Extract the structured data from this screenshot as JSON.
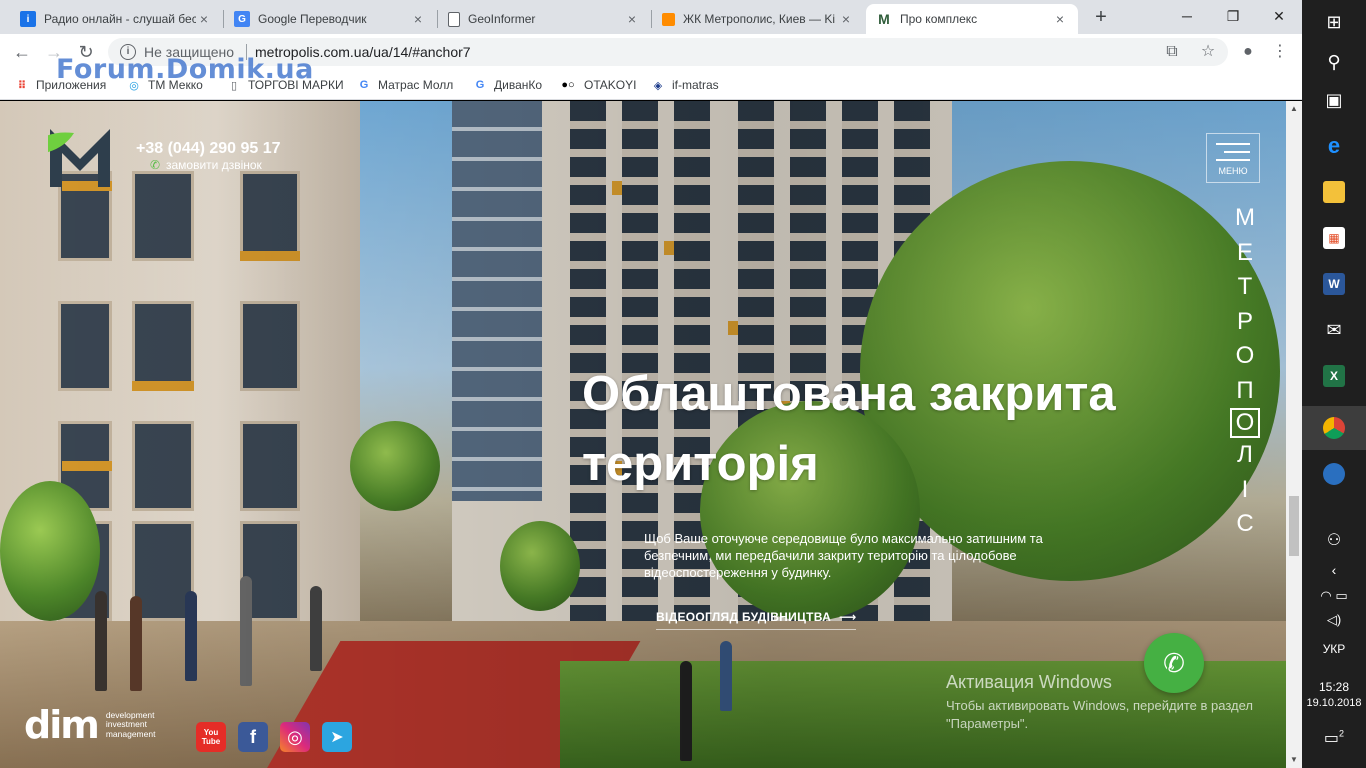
{
  "browser": {
    "tabs": [
      {
        "title": "Радио онлайн - слушай бес",
        "icon": "radio-icon",
        "color": "#1a73e8"
      },
      {
        "title": "Google Переводчик",
        "icon": "google-translate-icon",
        "color": "#4285f4"
      },
      {
        "title": "GeoInformer",
        "icon": "page-icon",
        "color": "#ffffff"
      },
      {
        "title": "ЖК Метрополис, Киев — Ki",
        "icon": "orange-square-icon",
        "color": "#ff8c00"
      },
      {
        "title": "Про комплекс",
        "icon": "metropolis-m-icon",
        "color": "#2f5d3a"
      }
    ],
    "address": {
      "security": "Не защищено",
      "url": "metropolis.com.ua/ua/14/#anchor7"
    },
    "bookmarks": [
      {
        "label": "Приложения",
        "icon": "apps-grid-icon"
      },
      {
        "label": "ТМ Мекко",
        "icon": "circle-logo-icon"
      },
      {
        "label": "ТОРГОВІ МАРКИ",
        "icon": "page-icon"
      },
      {
        "label": "Матрас Молл",
        "icon": "google-g-icon"
      },
      {
        "label": "ДиванКо",
        "icon": "google-g-icon"
      },
      {
        "label": "OTAKOYI",
        "icon": "dots-icon"
      },
      {
        "label": "if-matras",
        "icon": "diamond-logo-icon"
      }
    ],
    "watermark": "Forum.Domik.ua"
  },
  "site": {
    "phone": "+38 (044) 290 95 17",
    "callback": "замовити дзвінок",
    "menu_label": "МЕНЮ",
    "vertical_letters": [
      "М",
      "Е",
      "Т",
      "Р",
      "О",
      "П",
      "О",
      "Л",
      "І",
      "С"
    ],
    "headline_line1": "Облаштована закрита",
    "headline_line2": "територія",
    "description": "Щоб Ваше оточуюче середовище було максимально затишним та безпечним, ми передбачили закриту територію та цілодобове відеоспостереження у будинку.",
    "video_button": "ВІДЕООГЛЯД БУДІВНИЦТВА",
    "dim_mark": "dim",
    "dim_text_1": "development",
    "dim_text_2": "investment",
    "dim_text_3": "management",
    "social": [
      {
        "name": "youtube",
        "label": "You Tube",
        "color": "#e52d27"
      },
      {
        "name": "facebook",
        "label": "f",
        "color": "#3b5998"
      },
      {
        "name": "instagram",
        "label": "◎",
        "color": "#c13584"
      },
      {
        "name": "telegram",
        "label": "➤",
        "color": "#2ca5e0"
      }
    ]
  },
  "windows_activation": {
    "title": "Активация Windows",
    "body": "Чтобы активировать Windows, перейдите в раздел \"Параметры\"."
  },
  "taskbar": {
    "lang": "УКР",
    "time": "15:28",
    "date": "19.10.2018",
    "notif_count": "2"
  }
}
